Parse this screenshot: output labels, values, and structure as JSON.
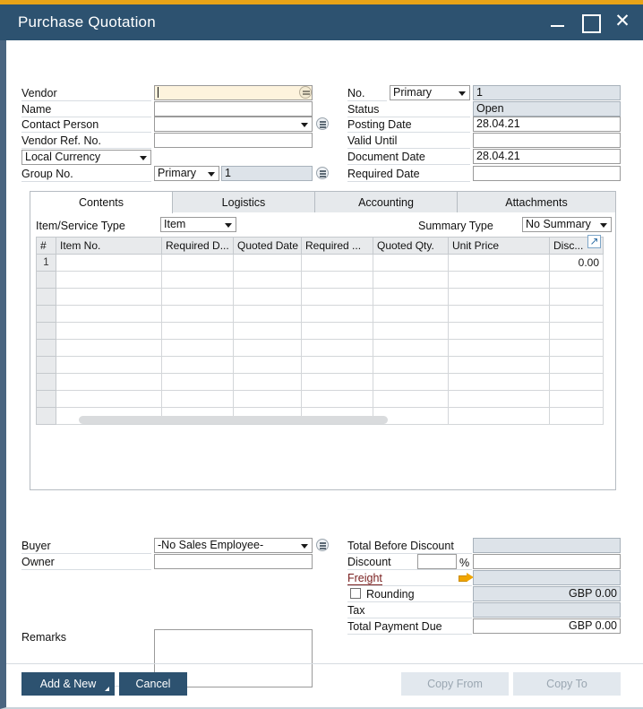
{
  "window": {
    "title": "Purchase Quotation",
    "accent_top": "#e8a317",
    "titlebar_bg": "#2d5270",
    "controls": {
      "minimize": "minimize-icon",
      "maximize": "maximize-icon",
      "close": "✕"
    }
  },
  "header_left": {
    "vendor_label": "Vendor",
    "vendor_value": "",
    "name_label": "Name",
    "name_value": "",
    "contact_person_label": "Contact Person",
    "contact_person_value": "",
    "vendor_ref_label": "Vendor Ref. No.",
    "vendor_ref_value": "",
    "currency_value": "Local Currency",
    "group_no_label": "Group No.",
    "group_no_type": "Primary",
    "group_no_value": "1"
  },
  "header_right": {
    "no_label": "No.",
    "no_series": "Primary",
    "no_value": "1",
    "status_label": "Status",
    "status_value": "Open",
    "posting_date_label": "Posting Date",
    "posting_date_value": "28.04.21",
    "valid_until_label": "Valid Until",
    "valid_until_value": "",
    "document_date_label": "Document Date",
    "document_date_value": "28.04.21",
    "required_date_label": "Required Date",
    "required_date_value": ""
  },
  "tabs": [
    {
      "label": "Contents",
      "active": true
    },
    {
      "label": "Logistics",
      "active": false
    },
    {
      "label": "Accounting",
      "active": false
    },
    {
      "label": "Attachments",
      "active": false
    }
  ],
  "contents": {
    "item_service_type_label": "Item/Service Type",
    "item_service_type_value": "Item",
    "summary_type_label": "Summary Type",
    "summary_type_value": "No Summary",
    "expand_icon": "open-in-new-icon",
    "grid": {
      "columns": [
        "#",
        "Item No.",
        "Required D...",
        "Quoted Date",
        "Required ...",
        "Quoted Qty.",
        "Unit Price",
        "Disc..."
      ],
      "rows": [
        {
          "num": "1",
          "item_no": "",
          "required_d": "",
          "quoted_date": "",
          "required": "",
          "quoted_qty": "",
          "unit_price": "",
          "disc": "0.00"
        }
      ],
      "empty_row_count": 9
    }
  },
  "footer_left": {
    "buyer_label": "Buyer",
    "buyer_value": "-No Sales Employee-",
    "owner_label": "Owner",
    "owner_value": "",
    "remarks_label": "Remarks",
    "remarks_value": ""
  },
  "totals": {
    "total_before_discount_label": "Total Before Discount",
    "total_before_discount_value": "",
    "discount_label": "Discount",
    "discount_percent_value": "",
    "discount_percent_symbol": "%",
    "discount_amount_value": "",
    "freight_label": "Freight",
    "freight_value": "",
    "freight_arrow_icon": "orange-arrow-icon",
    "rounding_label": "Rounding",
    "rounding_checked": false,
    "rounding_value": "GBP 0.00",
    "tax_label": "Tax",
    "tax_value": "",
    "total_payment_due_label": "Total Payment Due",
    "total_payment_due_value": "GBP 0.00"
  },
  "buttons": {
    "add_and_new": "Add & New",
    "cancel": "Cancel",
    "copy_from": "Copy From",
    "copy_to": "Copy To"
  }
}
